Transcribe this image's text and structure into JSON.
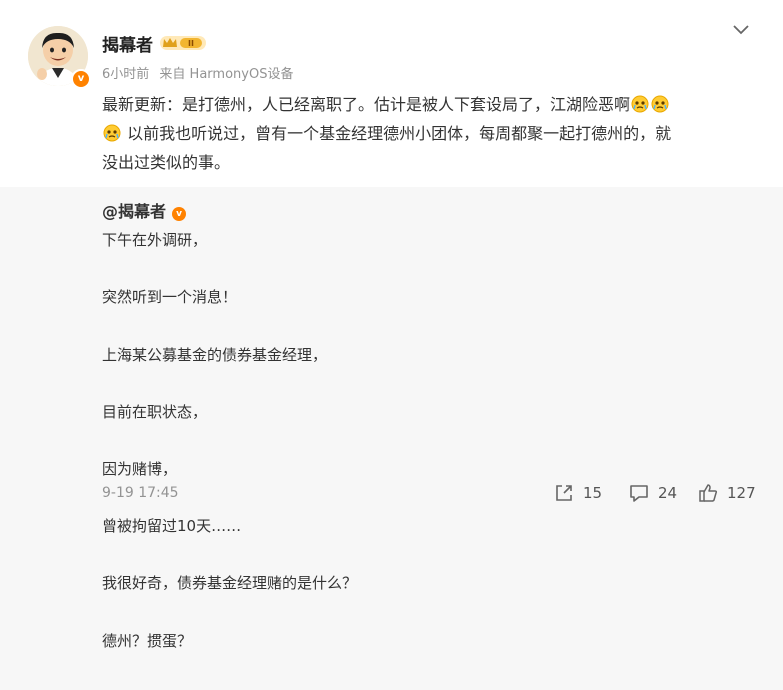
{
  "post": {
    "author": "揭幕者",
    "verified_mark": "v",
    "level_badge": "II",
    "time": "6小时前",
    "source": "来自 HarmonyOS设备",
    "text_1": "最新更新：是打德州，人已经离职了。估计是被人下套设局了，江湖险恶啊",
    "text_2": "以前我也听说过，曾有一个基金经理德州小团体，每周都聚一起打德州的，就",
    "text_3": "没出过类似的事。",
    "emoji_icon": "sad-crying-face-icon",
    "more_icon": "chevron-down-icon"
  },
  "repost": {
    "author": "@揭幕者",
    "verified_mark": "v",
    "lines": [
      "下午在外调研，",
      "突然听到一个消息！",
      "上海某公募基金的债券基金经理，",
      "目前在职状态，",
      "因为赌博，",
      "曾被拘留过10天……",
      "我很好奇，债券基金经理赌的是什么？",
      "德州？掼蛋？"
    ],
    "footer": {
      "time": "9-19 17:45",
      "share_count": "15",
      "comment_count": "24",
      "like_count": "127"
    }
  },
  "colors": {
    "accent_orange": "#ff8200",
    "meta_gray": "#939393",
    "panel_bg": "#f7f7f7"
  }
}
